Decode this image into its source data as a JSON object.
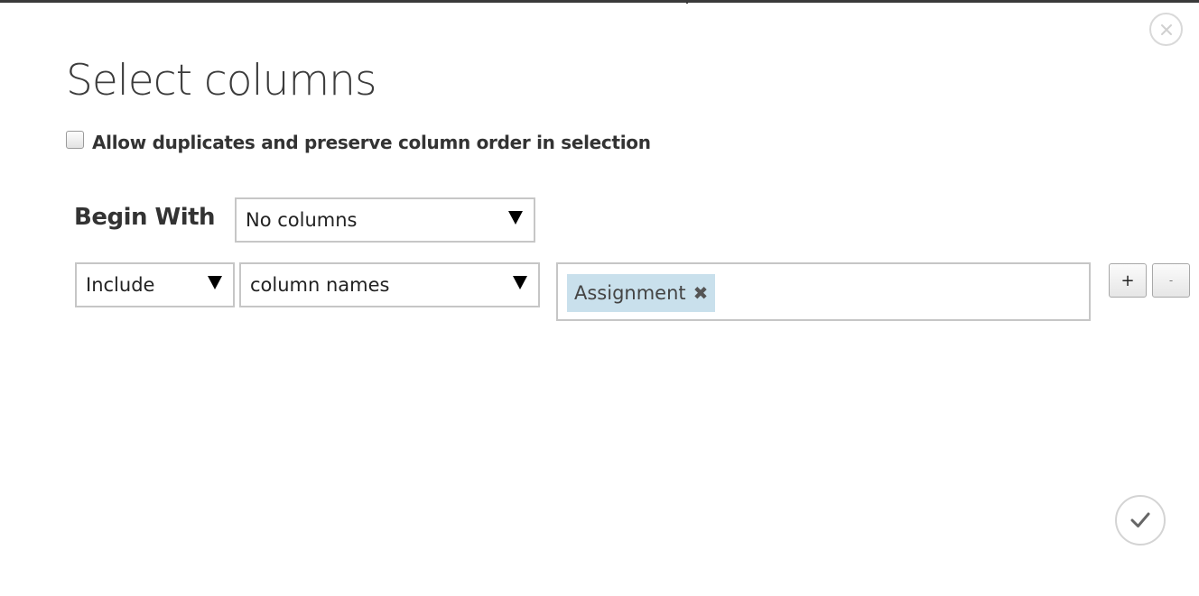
{
  "dialog": {
    "title": "Select columns",
    "close_icon": "close-circle-icon",
    "confirm_icon": "checkmark-circle-icon"
  },
  "options": {
    "allow_duplicates_label": "Allow duplicates and preserve column order in selection",
    "allow_duplicates_checked": false
  },
  "begin_with": {
    "label": "Begin With",
    "selected": "No columns"
  },
  "rule": {
    "mode_selected": "Include",
    "type_selected": "column names",
    "tags": [
      {
        "label": "Assignment",
        "remove_glyph": "✖"
      }
    ],
    "add_button_label": "+",
    "remove_button_label": "-"
  },
  "colors": {
    "tag_background": "#c9e0ec",
    "border": "#c6c6c6",
    "top_bar": "#3a3a3a"
  }
}
